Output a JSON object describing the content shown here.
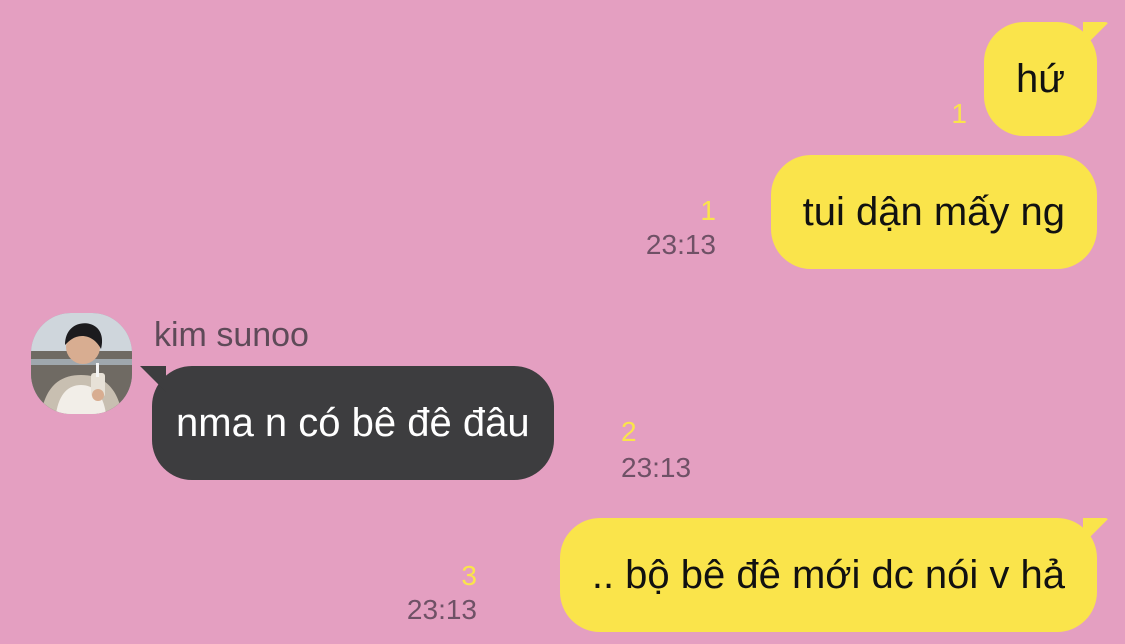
{
  "contact": {
    "name": "kim sunoo"
  },
  "messages": [
    {
      "direction": "outgoing",
      "text": "hứ",
      "unread_count": "1",
      "time": ""
    },
    {
      "direction": "outgoing",
      "text": "tui dận mấy ng",
      "unread_count": "1",
      "time": "23:13"
    },
    {
      "direction": "incoming",
      "text": "nma n có bê đê đâu",
      "unread_count": "2",
      "time": "23:13"
    },
    {
      "direction": "outgoing",
      "text": ".. bộ bê đê mới dc nói v hả",
      "unread_count": "3",
      "time": "23:13"
    }
  ],
  "colors": {
    "background": "#e49fc1",
    "outgoing_bubble": "#fae44b",
    "incoming_bubble": "#3d3d3f",
    "unread_count": "#fae44b",
    "timestamp": "#6f5166"
  }
}
